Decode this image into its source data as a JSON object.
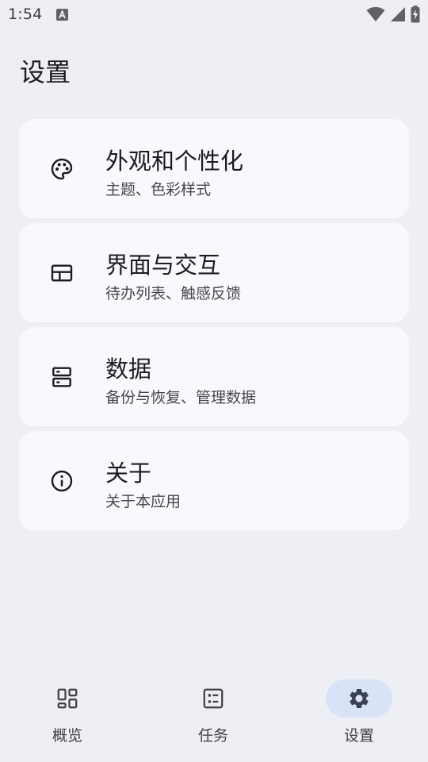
{
  "status_bar": {
    "time": "1:54",
    "icons": [
      "keyboard-a-icon",
      "wifi-icon",
      "signal-icon",
      "battery-charging-icon"
    ]
  },
  "header": {
    "title": "设置"
  },
  "settings": [
    {
      "title": "外观和个性化",
      "subtitle": "主题、色彩样式",
      "icon": "palette-icon"
    },
    {
      "title": "界面与交互",
      "subtitle": "待办列表、触感反馈",
      "icon": "layout-icon"
    },
    {
      "title": "数据",
      "subtitle": "备份与恢复、管理数据",
      "icon": "storage-icon"
    },
    {
      "title": "关于",
      "subtitle": "关于本应用",
      "icon": "info-icon"
    }
  ],
  "bottom_nav": {
    "items": [
      {
        "label": "概览",
        "icon": "dashboard-icon",
        "active": false
      },
      {
        "label": "任务",
        "icon": "task-list-icon",
        "active": false
      },
      {
        "label": "设置",
        "icon": "gear-icon",
        "active": true
      }
    ]
  },
  "colors": {
    "background": "#eeeff4",
    "card": "#f8f9fd",
    "active_pill": "#d9e3f8",
    "text_primary": "#1b1c20",
    "text_secondary": "#45474d"
  }
}
